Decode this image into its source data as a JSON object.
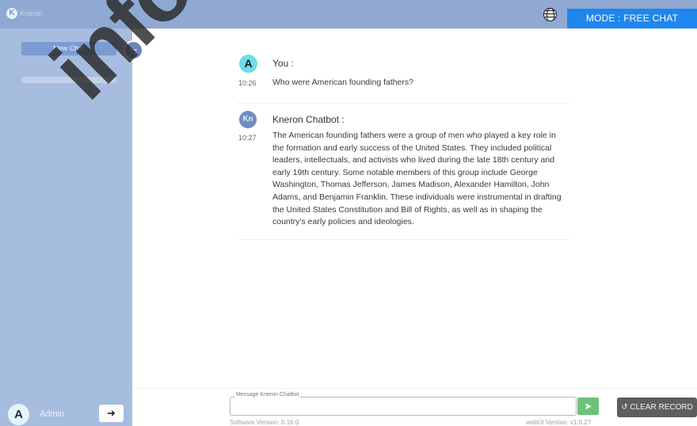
{
  "header": {
    "logo_text": "Kneron",
    "mode_label": "MODE : FREE CHAT"
  },
  "sidebar": {
    "new_chat_label": "New Chat",
    "user_initial": "A",
    "user_name": "Admin"
  },
  "watermark": "info",
  "messages": [
    {
      "avatar": "A",
      "sender": "You :",
      "time": "10:26",
      "text": "Who were American founding fathers?"
    },
    {
      "avatar": "Kn",
      "sender": "Kneron Chatbot :",
      "time": "10:27",
      "text": "The American founding fathers were a group of men who played a key role in the formation and early success of the United States. They included political leaders, intellectuals, and activists who lived during the late 18th century and early 19th century. Some notable members of this group include George Washington, Thomas Jefferson, James Madison, Alexander Hamilton, John Adams, and Benjamin Franklin. These individuals were instrumental in drafting the United States Constitution and Bill of Rights, as well as in shaping the country's early policies and ideologies."
    }
  ],
  "input": {
    "label": "Message Kneron Chatbot",
    "value": "",
    "placeholder": ""
  },
  "footer": {
    "clear_label": "↺ CLEAR RECORD",
    "software_version": "Software Version: 0.16.0",
    "webui_version": "webUI Version: v1.0.27"
  },
  "colors": {
    "topbar": "#8fa9d2",
    "sidebar": "#a7bddf",
    "mode_button": "#1f86ee",
    "send_button": "#6ec277",
    "clear_button": "#5e5e5e"
  },
  "icons": [
    "globe-icon",
    "swap-icon",
    "logout-icon",
    "send-icon",
    "refresh-icon"
  ]
}
